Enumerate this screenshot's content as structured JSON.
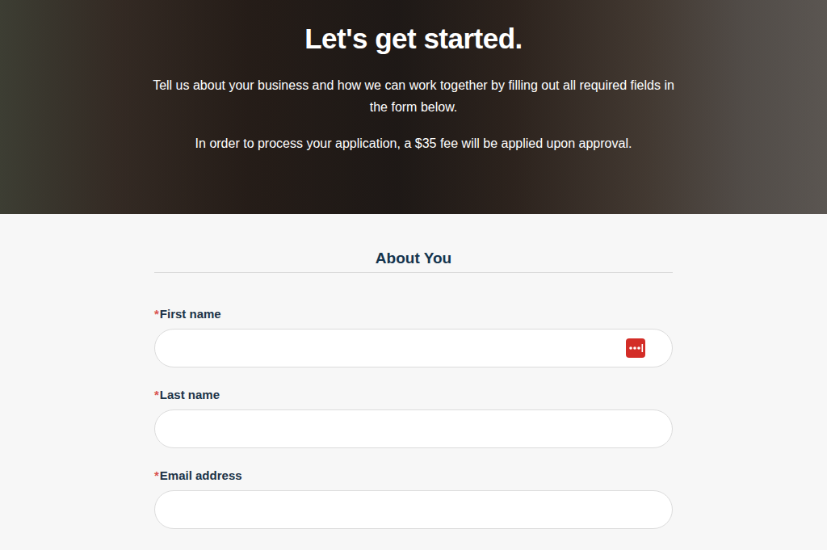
{
  "hero": {
    "title": "Let's get started.",
    "paragraphs": [
      "Tell us about your business and how we can work together by filling out all required fields in the form below.",
      "In order to process your application, a $35 fee will be applied upon approval."
    ]
  },
  "section": {
    "title": "About You"
  },
  "fields": [
    {
      "label": "First name",
      "marker": "*",
      "required": true,
      "autofill": true
    },
    {
      "label": "Last name",
      "marker": "*",
      "required": true,
      "autofill": false
    },
    {
      "label": "Email address",
      "marker": "*",
      "required": true,
      "autofill": false
    }
  ]
}
